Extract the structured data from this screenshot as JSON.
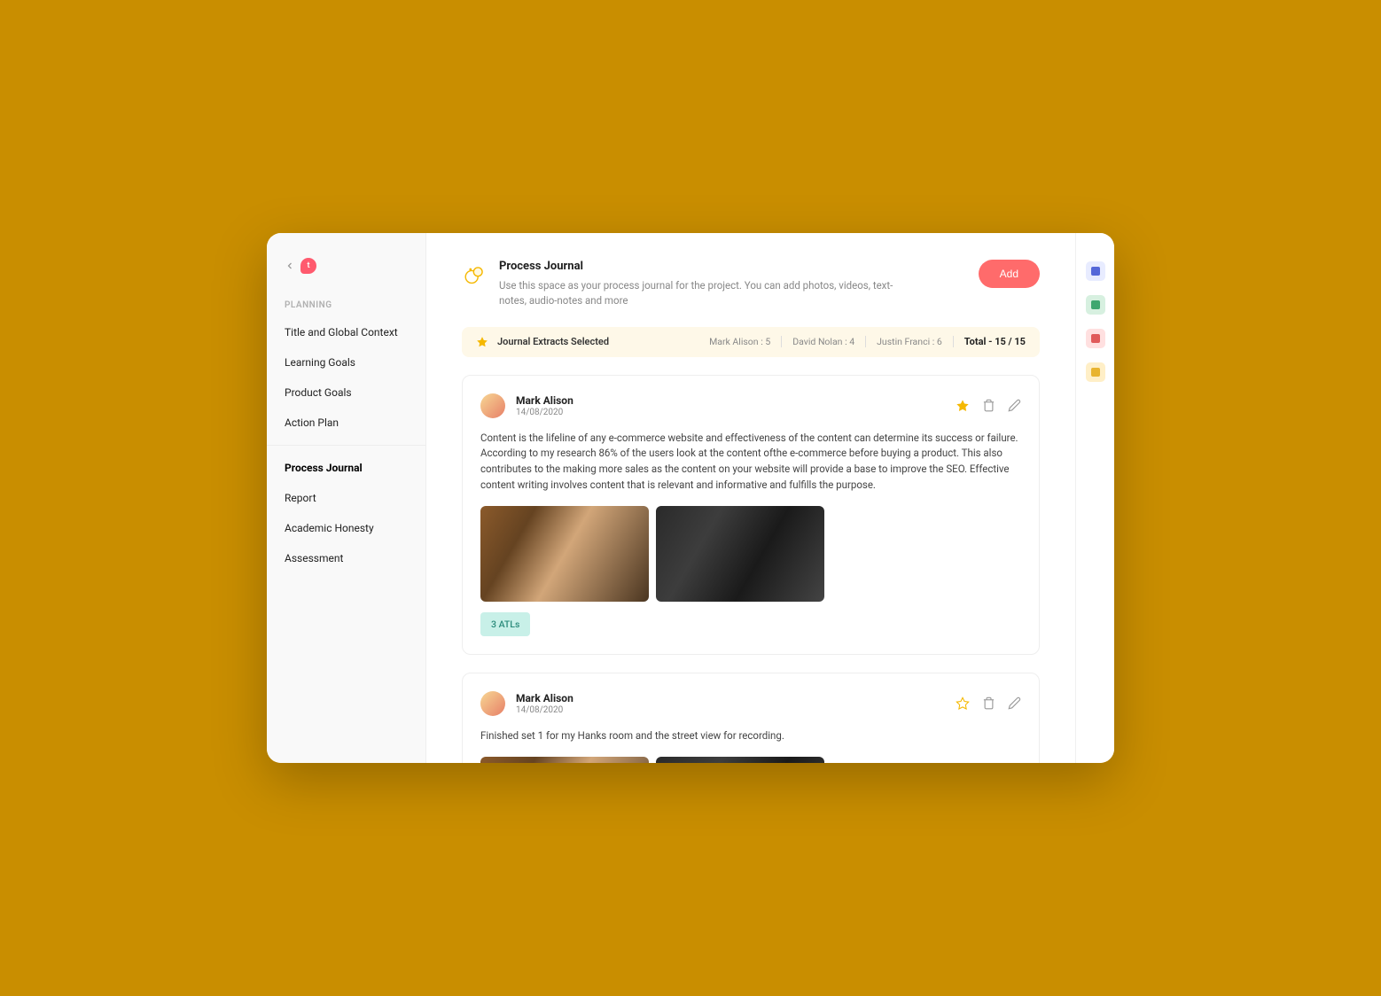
{
  "sidebar": {
    "logo_letter": "t",
    "section_label": "PLANNING",
    "items": [
      {
        "label": "Title and Global Context",
        "active": false
      },
      {
        "label": "Learning Goals",
        "active": false
      },
      {
        "label": "Product Goals",
        "active": false
      },
      {
        "label": "Action Plan",
        "active": false
      }
    ],
    "items2": [
      {
        "label": "Process Journal",
        "active": true
      },
      {
        "label": "Report",
        "active": false
      },
      {
        "label": "Academic Honesty",
        "active": false
      },
      {
        "label": "Assessment",
        "active": false
      }
    ]
  },
  "header": {
    "title": "Process  Journal",
    "subtitle": "Use this space as your process journal for the project. You can add photos, videos, text-notes, audio-notes and more",
    "add_button_label": "Add"
  },
  "extracts": {
    "label": "Journal Extracts Selected",
    "stats": [
      "Mark Alison : 5",
      "David Nolan : 4",
      "Justin Franci : 6"
    ],
    "total": "Total - 15 / 15"
  },
  "entries": [
    {
      "author": "Mark Alison",
      "date": "14/08/2020",
      "starred": true,
      "body": "Content is the lifeline of any e-commerce website and effectiveness of the content can determine its success or failure. According to my research 86% of the users look at the content ofthe e-commerce before buying a product. This also contributes to the making more sales as the content on your website will provide a base to improve the SEO. Effective content writing involves content that is relevant and informative and fulfills the purpose.",
      "atl_badge": "3  ATLs"
    },
    {
      "author": "Mark Alison",
      "date": "14/08/2020",
      "starred": false,
      "body": "Finished set 1 for my Hanks room and the street view for recording."
    }
  ],
  "rail_icons": [
    {
      "name": "calendar-icon",
      "color": "blue"
    },
    {
      "name": "notes-icon",
      "color": "green"
    },
    {
      "name": "book-icon",
      "color": "red"
    },
    {
      "name": "chat-icon",
      "color": "yellow"
    }
  ]
}
